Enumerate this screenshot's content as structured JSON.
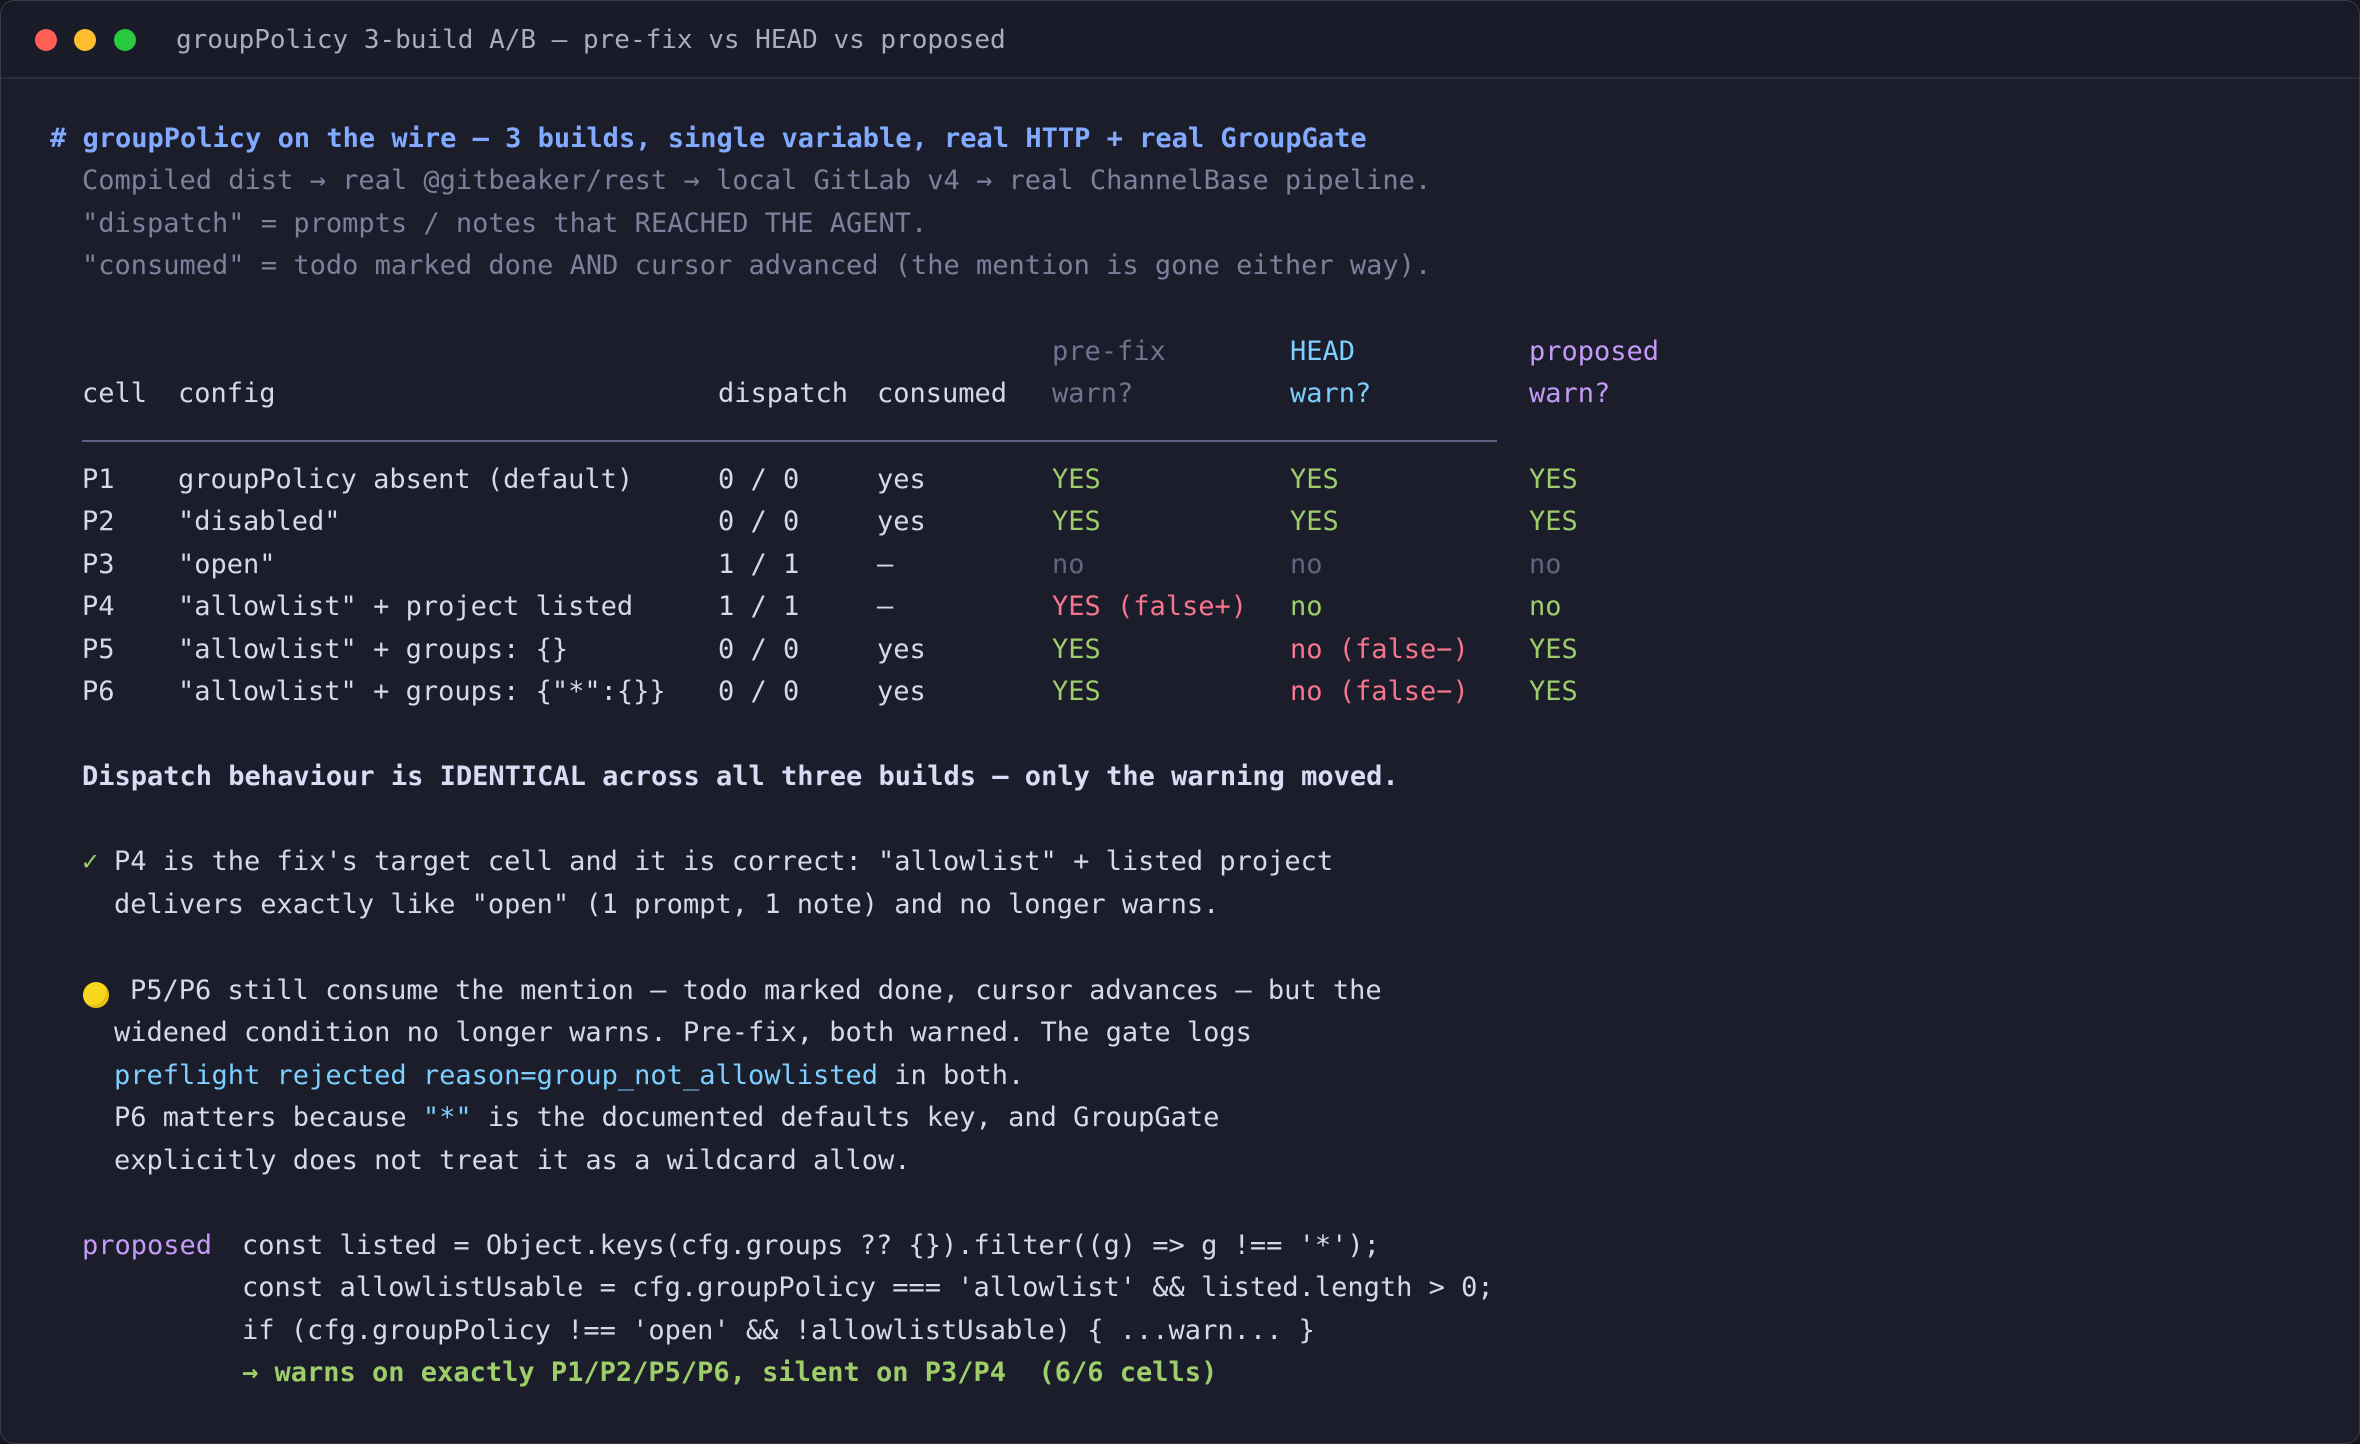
{
  "window": {
    "title": "groupPolicy 3-build A/B — pre-fix vs HEAD vs proposed"
  },
  "header": {
    "title": "# groupPolicy on the wire — 3 builds, single variable, real HTTP + real GroupGate",
    "lines": [
      "Compiled dist → real @gitbeaker/rest → local GitLab v4 → real ChannelBase pipeline.",
      "\"dispatch\" = prompts / notes that REACHED THE AGENT.",
      "\"consumed\" = todo marked done AND cursor advanced (the mention is gone either way)."
    ]
  },
  "table": {
    "columns": {
      "cell": "cell",
      "config": "config",
      "dispatch": "dispatch",
      "consumed": "consumed",
      "prefix_top": "pre-fix",
      "prefix_bottom": "warn?",
      "head_top": "HEAD",
      "head_bottom": "warn?",
      "proposed_top": "proposed",
      "proposed_bottom": "warn?"
    },
    "rows": [
      {
        "cell": "P1",
        "config": "groupPolicy absent (default)",
        "dispatch": "0 / 0",
        "consumed": "yes",
        "prefix": "YES",
        "head": "YES",
        "proposed": "YES"
      },
      {
        "cell": "P2",
        "config": "\"disabled\"",
        "dispatch": "0 / 0",
        "consumed": "yes",
        "prefix": "YES",
        "head": "YES",
        "proposed": "YES"
      },
      {
        "cell": "P3",
        "config": "\"open\"",
        "dispatch": "1 / 1",
        "consumed": "—",
        "prefix": "no",
        "head": "no",
        "proposed": "no"
      },
      {
        "cell": "P4",
        "config": "\"allowlist\" + project listed",
        "dispatch": "1 / 1",
        "consumed": "—",
        "prefix": "YES (false+)",
        "head": "no",
        "proposed": "no"
      },
      {
        "cell": "P5",
        "config": "\"allowlist\" + groups: {}",
        "dispatch": "0 / 0",
        "consumed": "yes",
        "prefix": "YES",
        "head": "no (false−)",
        "proposed": "YES"
      },
      {
        "cell": "P6",
        "config": "\"allowlist\" + groups: {\"*\":{}}",
        "dispatch": "0 / 0",
        "consumed": "yes",
        "prefix": "YES",
        "head": "no (false−)",
        "proposed": "YES"
      }
    ]
  },
  "summary": "Dispatch behaviour is IDENTICAL across all three builds — only the warning moved.",
  "note_ok": {
    "mark": "✓",
    "line1": "P4 is the fix's target cell and it is correct: \"allowlist\" + listed project",
    "line2": "delivers exactly like \"open\" (1 prompt, 1 note) and no longer warns."
  },
  "note_warn": {
    "line1": "P5/P6 still consume the mention — todo marked done, cursor advances — but the",
    "line2": "widened condition no longer warns. Pre-fix, both warned. The gate logs",
    "line3_code": "preflight rejected reason=group_not_allowlisted",
    "line3_rest": " in both.",
    "line4_a": "P6 matters because ",
    "line4_code": "\"*\"",
    "line4_b": " is the documented defaults key, and GroupGate",
    "line5": "explicitly does not treat it as a wildcard allow."
  },
  "proposed": {
    "label": "proposed",
    "code": [
      "const listed = Object.keys(cfg.groups ?? {}).filter((g) => g !== '*');",
      "const allowlistUsable = cfg.groupPolicy === 'allowlist' && listed.length > 0;",
      "if (cfg.groupPolicy !== 'open' && !allowlistUsable) { ...warn... }"
    ],
    "result": "→ warns on exactly P1/P2/P5/P6, silent on P3/P4  (6/6 cells)"
  }
}
